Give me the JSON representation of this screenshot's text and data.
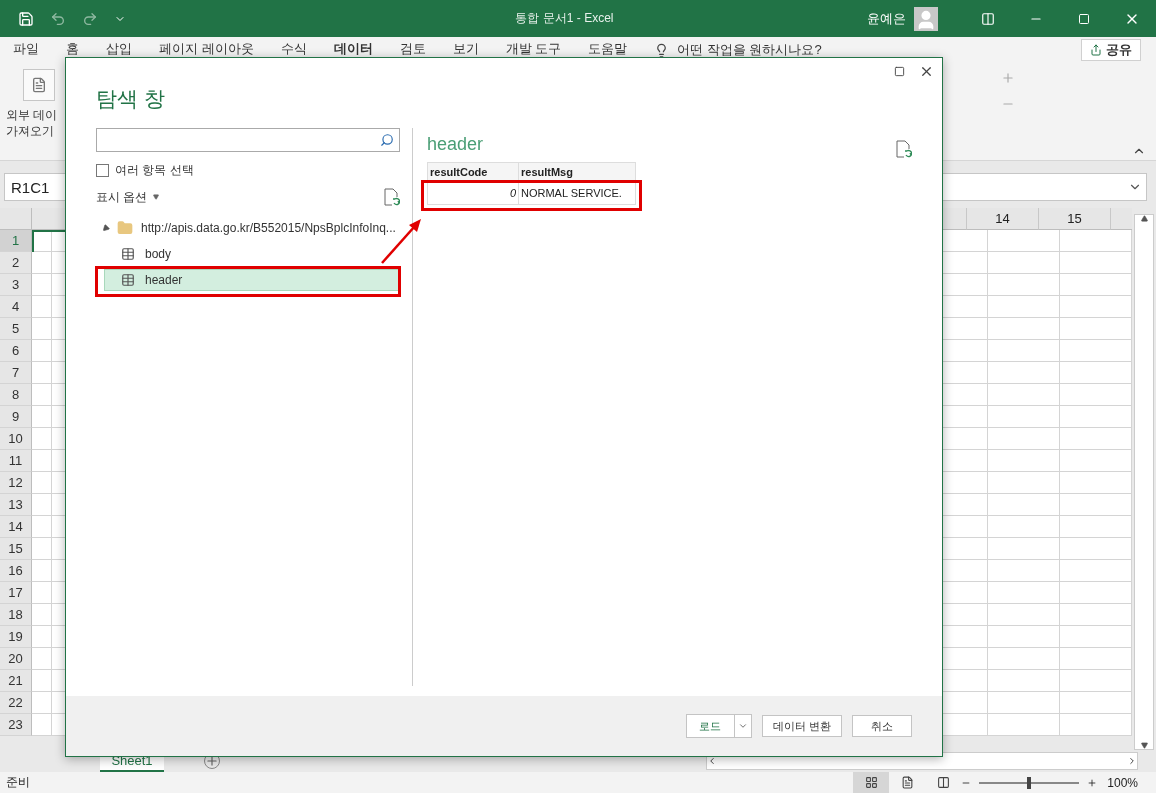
{
  "app": {
    "title": "통합 문서1  -  Excel",
    "user": "윤예은"
  },
  "menu_tabs": [
    {
      "label": "파일",
      "selected": false
    },
    {
      "label": "홈",
      "selected": false
    },
    {
      "label": "삽입",
      "selected": false
    },
    {
      "label": "페이지 레이아웃",
      "selected": false
    },
    {
      "label": "수식",
      "selected": false
    },
    {
      "label": "데이터",
      "selected": true
    },
    {
      "label": "검토",
      "selected": false
    },
    {
      "label": "보기",
      "selected": false
    },
    {
      "label": "개발 도구",
      "selected": false
    },
    {
      "label": "도움말",
      "selected": false
    }
  ],
  "tell_me": "어떤 작업을 원하시나요?",
  "share_button": "공유",
  "ribbon": {
    "get_data_lines": [
      "외부 데이",
      "가져오기"
    ]
  },
  "name_box": "R1C1",
  "columns": [
    "14",
    "15"
  ],
  "rows": [
    "1",
    "2",
    "3",
    "4",
    "5",
    "6",
    "7",
    "8",
    "9",
    "10",
    "11",
    "12",
    "13",
    "14",
    "15",
    "16",
    "17",
    "18",
    "19",
    "20",
    "21",
    "22",
    "23"
  ],
  "sheet_tabs": [
    {
      "label": "Sheet1",
      "selected": true
    }
  ],
  "status": {
    "text": "준비",
    "zoom": {
      "reading": "100%",
      "level": 0.5
    }
  },
  "dialog": {
    "title": "탐색 창",
    "multi_select": {
      "label": "여러 항목 선택",
      "checked": false
    },
    "display_options": "표시 옵션",
    "tree": [
      {
        "label": "http://apis.data.go.kr/B552015/NpsBplcInfoInq...",
        "expanded": true,
        "children": [
          {
            "label": "body",
            "selected": false
          },
          {
            "label": "header",
            "selected": true
          }
        ]
      }
    ],
    "preview": {
      "title": "header",
      "columns": [
        "resultCode",
        "resultMsg"
      ],
      "rows": [
        [
          "0",
          "NORMAL SERVICE."
        ]
      ]
    },
    "buttons": [
      {
        "label": "로드",
        "kind": "split"
      },
      {
        "label": "데이터 변환",
        "kind": "plain"
      },
      {
        "label": "취소",
        "kind": "plain"
      }
    ]
  }
}
